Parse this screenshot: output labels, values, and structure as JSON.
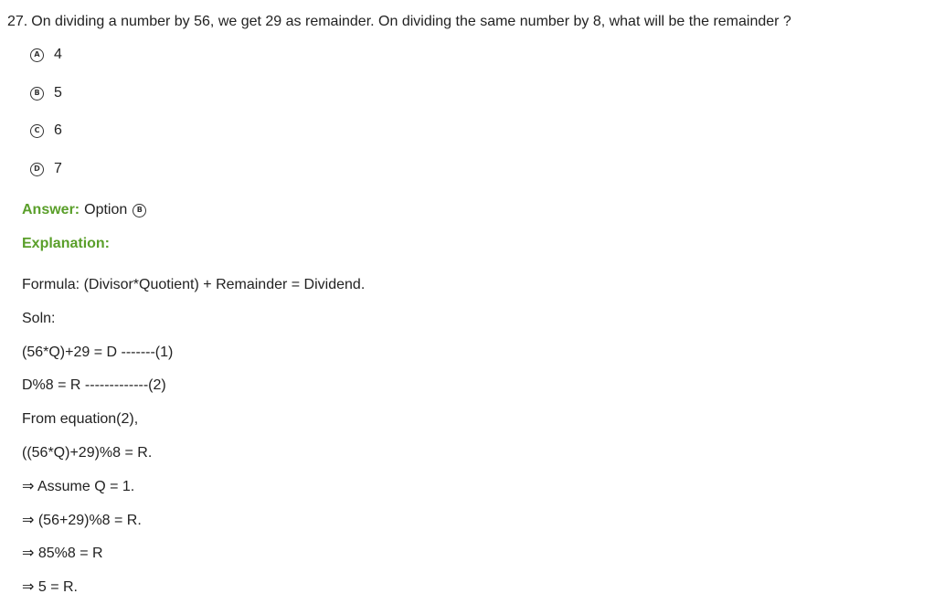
{
  "question": {
    "number": "27.",
    "text": "On dividing a number by 56, we get 29 as remainder. On dividing the same number by 8, what will be the remainder ?"
  },
  "options": [
    {
      "letter": "A",
      "value": "4"
    },
    {
      "letter": "B",
      "value": "5"
    },
    {
      "letter": "C",
      "value": "6"
    },
    {
      "letter": "D",
      "value": "7"
    }
  ],
  "answer": {
    "label": "Answer:",
    "text": "Option",
    "letter": "B"
  },
  "explanation": {
    "label": "Explanation:",
    "lines": [
      "Formula: (Divisor*Quotient) + Remainder = Dividend.",
      "Soln:",
      "(56*Q)+29 = D -------(1)",
      "D%8 = R -------------(2)",
      "From equation(2),",
      "((56*Q)+29)%8 = R.",
      "⇒ Assume Q = 1.",
      "⇒ (56+29)%8 = R.",
      "⇒ 85%8 = R",
      "⇒ 5 = R."
    ]
  },
  "colors": {
    "accent_green": "#5a9f2a",
    "text": "#222222"
  }
}
